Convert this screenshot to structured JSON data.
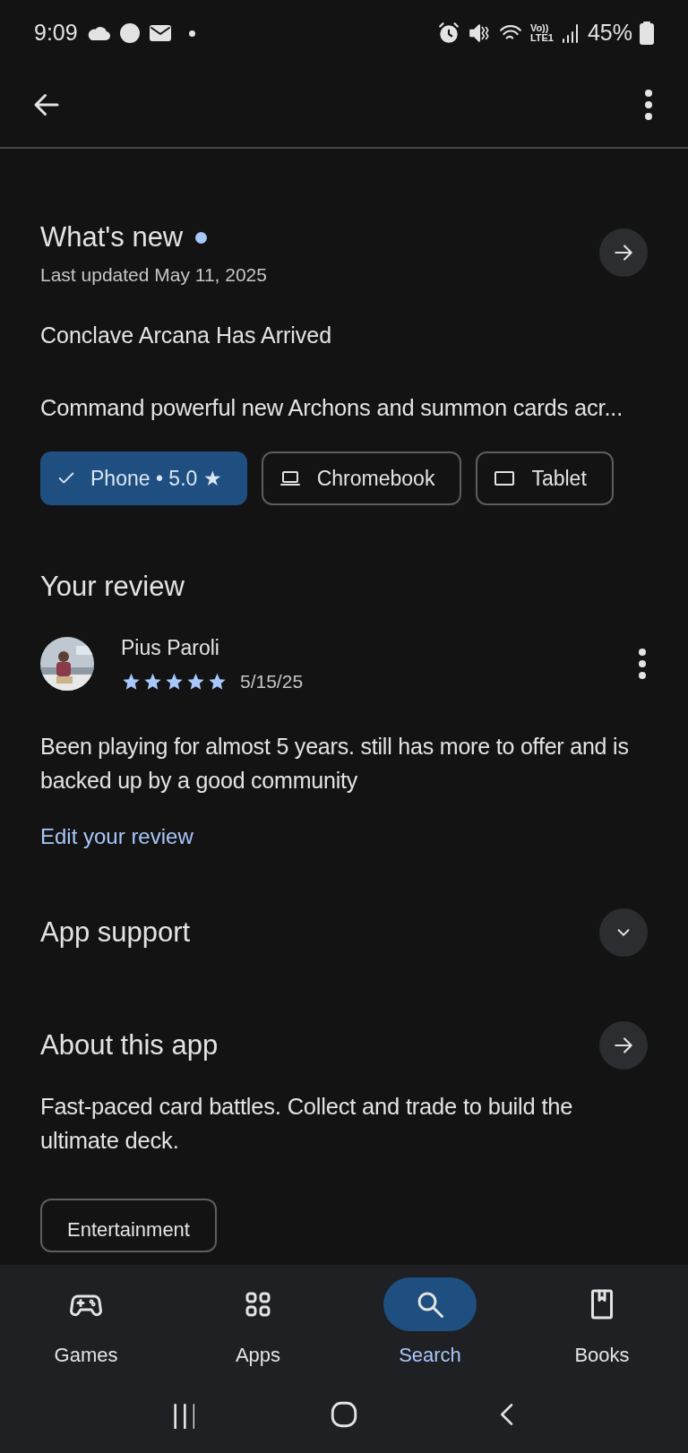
{
  "status_bar": {
    "time": "9:09",
    "network_top": "Vo))",
    "network_bottom": "LTE1",
    "battery": "45%"
  },
  "whats_new": {
    "title": "What's new",
    "unread": true,
    "updated": "Last updated May 11, 2025",
    "headline": "Conclave Arcana Has Arrived",
    "body": "Command powerful new Archons and summon cards acr..."
  },
  "devices": [
    {
      "kind": "phone",
      "label": "Phone • 5.0 ★",
      "selected": true
    },
    {
      "kind": "laptop",
      "label": "Chromebook",
      "selected": false
    },
    {
      "kind": "tablet",
      "label": "Tablet",
      "selected": false
    }
  ],
  "your_review": {
    "title": "Your review",
    "name": "Pius Paroli",
    "stars": 5,
    "date": "5/15/25",
    "text": "Been playing for almost 5 years. still has more to offer and is backed up by a good community",
    "edit": "Edit your review"
  },
  "app_support": {
    "title": "App support",
    "expanded": false
  },
  "about": {
    "title": "About this app",
    "text": "Fast-paced card battles. Collect and trade to build the ultimate deck.",
    "tags": [
      "Entertainment"
    ]
  },
  "nav": [
    {
      "kind": "games",
      "label": "Games",
      "selected": false
    },
    {
      "kind": "apps",
      "label": "Apps",
      "selected": false
    },
    {
      "kind": "search",
      "label": "Search",
      "selected": true
    },
    {
      "kind": "books",
      "label": "Books",
      "selected": false
    }
  ]
}
